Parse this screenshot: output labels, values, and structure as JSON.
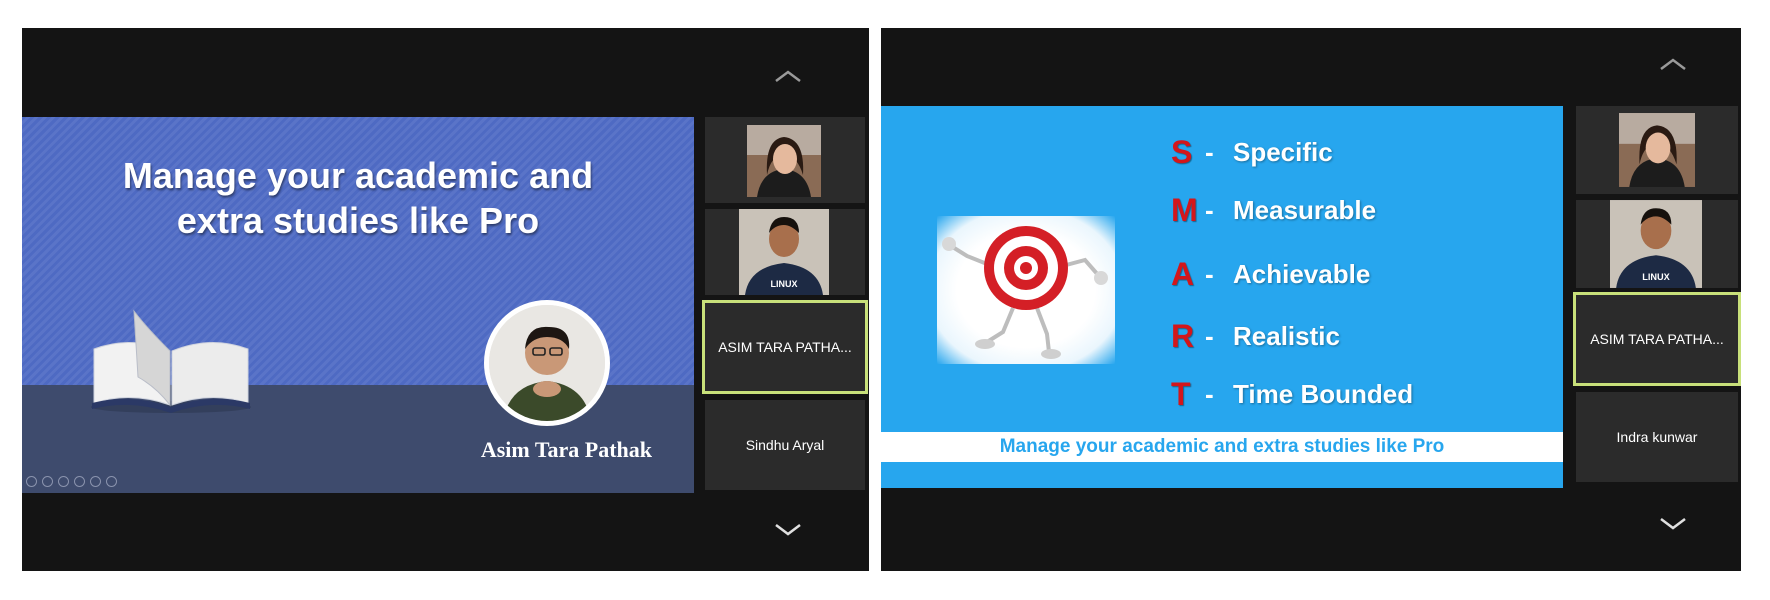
{
  "left_panel": {
    "slide": {
      "title_line1": "Manage your academic and",
      "title_line2": "extra studies like Pro",
      "presenter_name": "Asim Tara Pathak",
      "background_color": "#4e6ac3",
      "floor_color": "#3e4b6d",
      "control_icons": [
        "prev-icon",
        "next-icon",
        "pen-icon",
        "slides-icon",
        "zoom-icon",
        "more-icon"
      ]
    },
    "scroll_up_icon": "chevron-up-icon",
    "scroll_down_icon": "chevron-down-icon",
    "participants": [
      {
        "type": "video",
        "subject": "woman-video-icon"
      },
      {
        "type": "video",
        "subject": "man-linux-shirt-video-icon",
        "shirt_text": "LINUX"
      },
      {
        "type": "name",
        "name": "ASIM TARA PATHA...",
        "active": true
      },
      {
        "type": "name",
        "name": "Sindhu Aryal"
      }
    ]
  },
  "right_panel": {
    "slide": {
      "background_color": "#27a6ee",
      "letter_color": "#d3161b",
      "smart": [
        {
          "letter": "S",
          "dash": "-",
          "word": "Specific"
        },
        {
          "letter": "M",
          "dash": "-",
          "word": "Measurable"
        },
        {
          "letter": "A",
          "dash": "-",
          "word": "Achievable"
        },
        {
          "letter": "R",
          "dash": "-",
          "word": "Realistic"
        },
        {
          "letter": "T",
          "dash": "-",
          "word": "Time Bounded"
        }
      ],
      "footer": "Manage your academic and extra studies like Pro",
      "illustration": "target-character-icon"
    },
    "scroll_up_icon": "chevron-up-icon",
    "scroll_down_icon": "chevron-down-icon",
    "participants": [
      {
        "type": "video",
        "subject": "woman-video-icon"
      },
      {
        "type": "video",
        "subject": "man-linux-shirt-video-icon",
        "shirt_text": "LINUX"
      },
      {
        "type": "name",
        "name": "ASIM TARA PATHA...",
        "active": true
      },
      {
        "type": "name",
        "name": "Indra kunwar"
      }
    ]
  },
  "colors": {
    "active_border": "#c8e07a",
    "tile_bg": "#2b2b2b",
    "panel_bg": "#141414"
  }
}
